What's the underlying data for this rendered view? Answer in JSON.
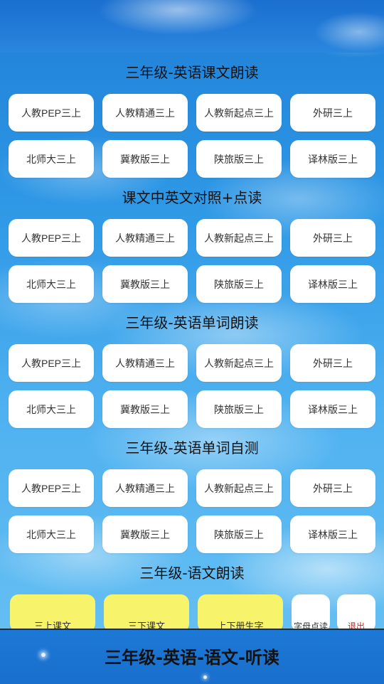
{
  "sections": [
    {
      "title": "三年级-英语课文朗读",
      "buttons": [
        "人教PEP三上",
        "人教精通三上",
        "人教新起点三上",
        "外研三上",
        "北师大三上",
        "冀教版三上",
        "陕旅版三上",
        "译林版三上"
      ]
    },
    {
      "title": "课文中英文对照+点读",
      "buttons": [
        "人教PEP三上",
        "人教精通三上",
        "人教新起点三上",
        "外研三上",
        "北师大三上",
        "冀教版三上",
        "陕旅版三上",
        "译林版三上"
      ]
    },
    {
      "title": "三年级-英语单词朗读",
      "buttons": [
        "人教PEP三上",
        "人教精通三上",
        "人教新起点三上",
        "外研三上",
        "北师大三上",
        "冀教版三上",
        "陕旅版三上",
        "译林版三上"
      ]
    },
    {
      "title": "三年级-英语单词自测",
      "buttons": [
        "人教PEP三上",
        "人教精通三上",
        "人教新起点三上",
        "外研三上",
        "北师大三上",
        "冀教版三上",
        "陕旅版三上",
        "译林版三上"
      ]
    }
  ],
  "chinese_section": {
    "title": "三年级-语文朗读",
    "buttons": [
      "三上课文",
      "三下课文",
      "上下册生字"
    ],
    "letters_button": "字母点读",
    "exit_button": "退出"
  },
  "footer": {
    "title": "三年级-英语-语文-听读"
  },
  "colors": {
    "accent_yellow": "#f7f36a",
    "exit_red": "#d81b1b",
    "footer_blue": "#1c78d6"
  }
}
